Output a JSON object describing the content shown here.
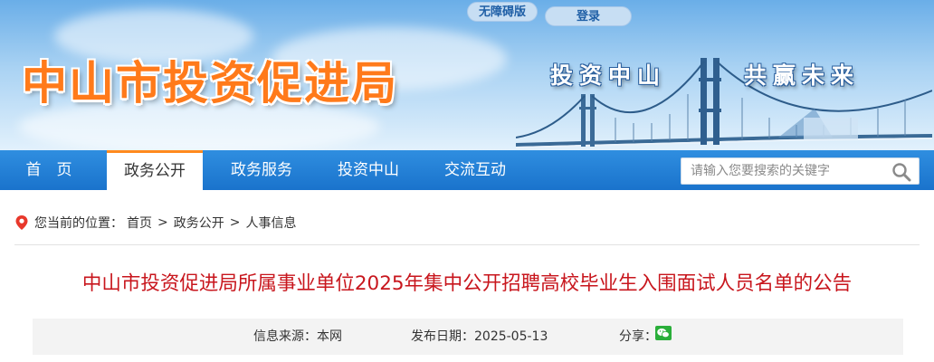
{
  "header": {
    "site_title": "中山市投资促进局",
    "slogan_left": "投资中山",
    "slogan_right": "共赢未来",
    "accessibility_label": "无障碍版",
    "login_label": "登录"
  },
  "nav": {
    "items": [
      {
        "label": "首　页"
      },
      {
        "label": "政务公开"
      },
      {
        "label": "政务服务"
      },
      {
        "label": "投资中山"
      },
      {
        "label": "交流互动"
      }
    ],
    "active": "政务公开",
    "search_placeholder": "请输入您要搜索的关键字"
  },
  "breadcrumb": {
    "prefix": "您当前的位置：",
    "items": [
      "首页",
      "政务公开",
      "人事信息"
    ],
    "separator": ">"
  },
  "article": {
    "title": "中山市投资促进局所属事业单位2025年集中公开招聘高校毕业生入围面试人员名单的公告",
    "source_label": "信息来源：",
    "source_value": "本网",
    "date_label": "发布日期：",
    "date_value": "2025-05-13",
    "share_label": "分享："
  },
  "colors": {
    "nav_blue": "#1a73cc",
    "title_orange": "#ff7a1a",
    "article_title_red": "#c8161d",
    "active_tab_accent": "#ff8a1f",
    "wechat_green": "#2aae3a"
  },
  "icons": {
    "location": "location-pin-icon",
    "search": "search-icon",
    "share_wechat": "wechat-icon"
  }
}
